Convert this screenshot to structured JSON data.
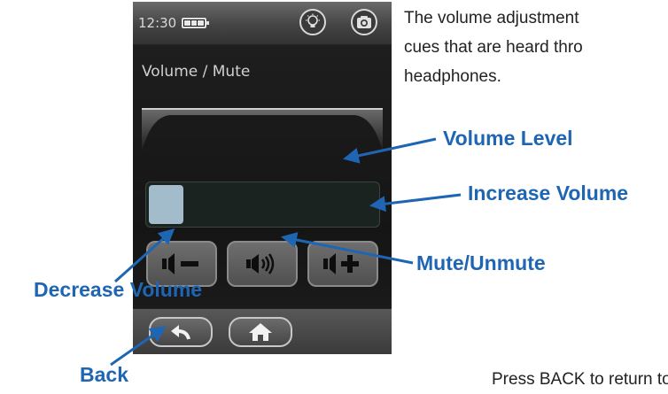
{
  "device": {
    "status": {
      "time": "12:30"
    },
    "screen_title": "Volume / Mute",
    "volume": {
      "level_fraction": 0.15
    }
  },
  "description": {
    "lines": [
      "The volume adjustment",
      "cues that are heard thro",
      "headphones."
    ],
    "footer": "Press BACK to return to th"
  },
  "annotations": {
    "volume_level": "Volume Level",
    "increase_volume": "Increase Volume",
    "mute_unmute": "Mute/Unmute",
    "decrease_volume": "Decrease Volume",
    "back": "Back"
  },
  "colors": {
    "annotation": "#1e66b4",
    "slider_knob": "#a3bccc"
  },
  "icons": {
    "status": [
      "battery-icon",
      "lightbulb-icon",
      "camera-icon"
    ],
    "controls": [
      "volume-decrease-icon",
      "volume-mute-toggle-icon",
      "volume-increase-icon"
    ],
    "nav": [
      "back-arrow-icon",
      "home-icon"
    ]
  }
}
